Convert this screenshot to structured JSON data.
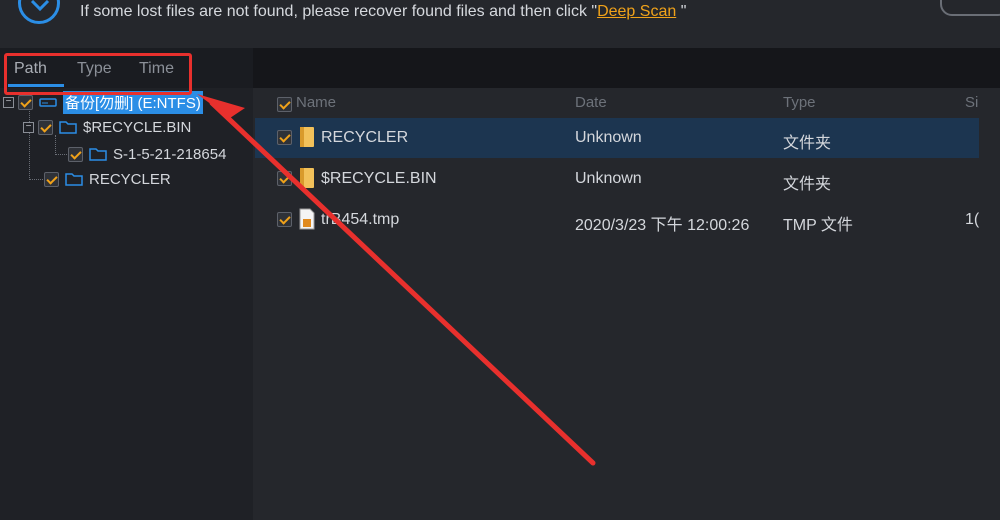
{
  "banner": {
    "message_prefix": "If some lost files are not found, please recover found files and then click \"",
    "link_label": "Deep Scan",
    "message_suffix": "\""
  },
  "tabs": [
    {
      "label": "Path"
    },
    {
      "label": "Type"
    },
    {
      "label": "Time"
    }
  ],
  "tree": {
    "root": "备份[勿删] (E:NTFS)",
    "items": [
      {
        "label": "$RECYCLE.BIN"
      },
      {
        "label": "S-1-5-21-218654"
      },
      {
        "label": "RECYCLER"
      }
    ]
  },
  "list": {
    "columns": [
      "Name",
      "Date",
      "Type",
      "Si"
    ],
    "rows": [
      {
        "name": "RECYCLER",
        "date": "Unknown",
        "type": "文件夹",
        "size": ""
      },
      {
        "name": "$RECYCLE.BIN",
        "date": "Unknown",
        "type": "文件夹",
        "size": ""
      },
      {
        "name": "trB454.tmp",
        "date": "2020/3/23 下午 12:00:26",
        "type": "TMP 文件",
        "size": "1("
      }
    ]
  },
  "colors": {
    "accent": "#2b8ee6",
    "link": "#f0a21a",
    "annotation": "#e8302d",
    "selected_row": "#1c3550"
  }
}
